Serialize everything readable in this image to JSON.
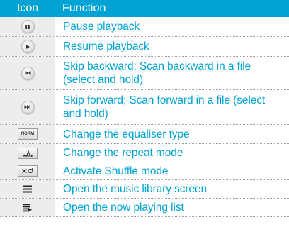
{
  "header": {
    "icon_col": "Icon",
    "function_col": "Function"
  },
  "rows": [
    {
      "icon": "pause-icon",
      "function": "Pause playback"
    },
    {
      "icon": "play-icon",
      "function": "Resume playback"
    },
    {
      "icon": "skip-backward-icon",
      "function": "Skip backward; Scan backward in a file (select and hold)"
    },
    {
      "icon": "skip-forward-icon",
      "function": "Skip forward; Scan forward in a file (select and hold)"
    },
    {
      "icon": "equaliser-icon",
      "icon_text": "NORM",
      "function": "Change the equaliser type"
    },
    {
      "icon": "repeat-mode-icon",
      "function": "Change the repeat mode"
    },
    {
      "icon": "shuffle-icon",
      "function": "Activate Shuffle mode"
    },
    {
      "icon": "music-library-icon",
      "function": "Open the music library screen"
    },
    {
      "icon": "now-playing-list-icon",
      "function": "Open the now playing list"
    }
  ],
  "colors": {
    "header_bg": "#00a3d3",
    "text": "#00a3d3",
    "icon_cell_bg": "#ededed"
  }
}
